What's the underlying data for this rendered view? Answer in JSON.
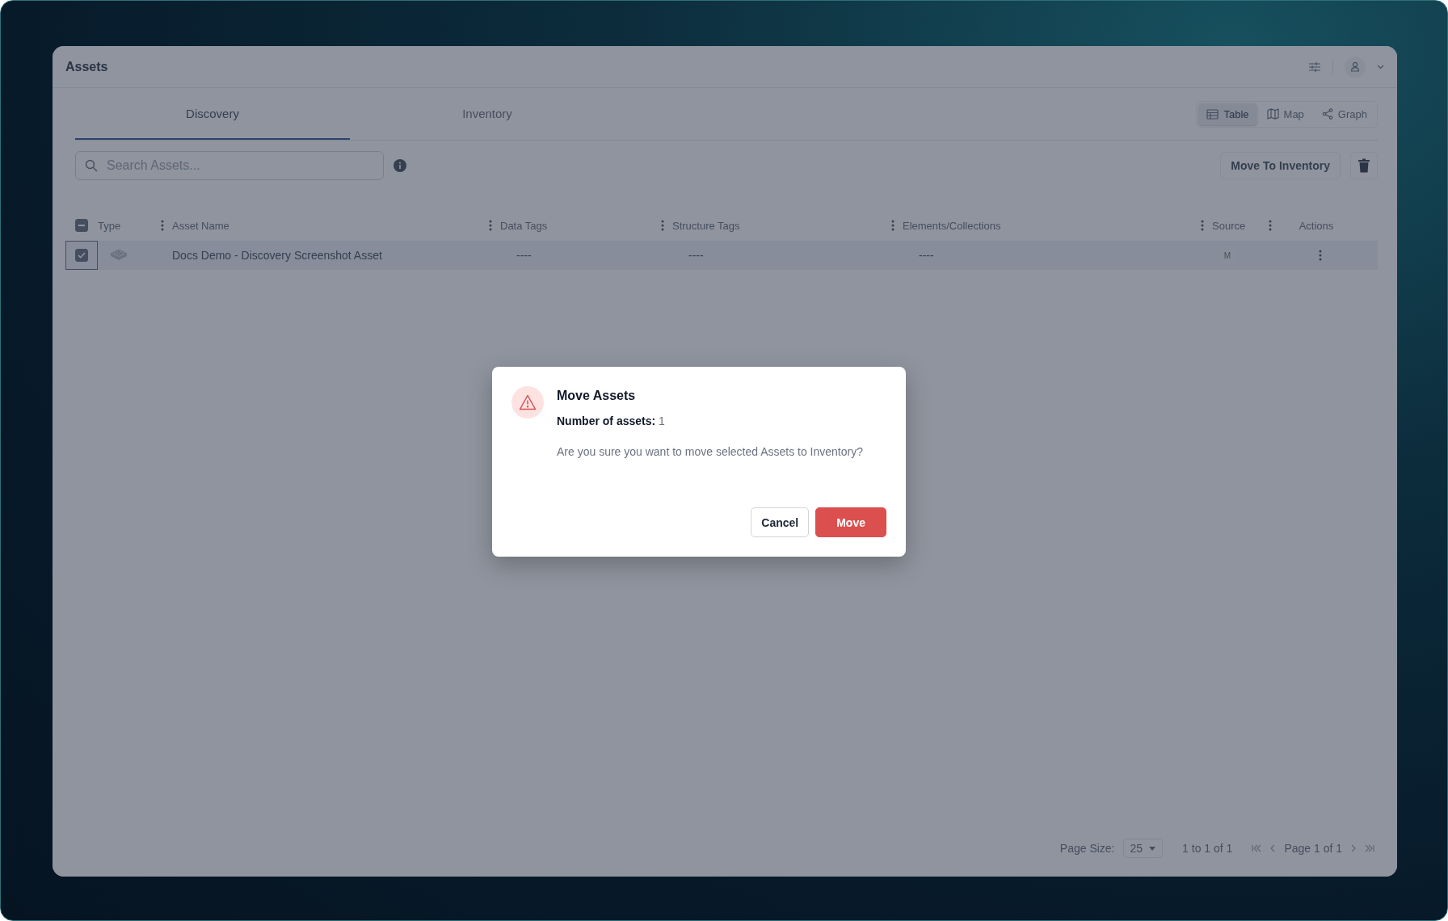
{
  "app": {
    "title": "Assets"
  },
  "tabs": [
    {
      "label": "Discovery",
      "selected": true
    },
    {
      "label": "Inventory",
      "selected": false
    }
  ],
  "views": [
    {
      "label": "Table",
      "kind": "table",
      "selected": true
    },
    {
      "label": "Map",
      "kind": "map",
      "selected": false
    },
    {
      "label": "Graph",
      "kind": "graph",
      "selected": false
    }
  ],
  "search": {
    "placeholder": "Search Assets..."
  },
  "toolbar": {
    "move_button": "Move To Inventory"
  },
  "table": {
    "select_all": {
      "indeterminate": true
    },
    "columns": [
      {
        "label": "Type",
        "menu": true
      },
      {
        "label": "Asset Name",
        "menu": true
      },
      {
        "label": "Data Tags",
        "menu": true
      },
      {
        "label": "Structure Tags",
        "menu": true
      },
      {
        "label": "Elements/Collections",
        "menu": true
      },
      {
        "label": "Source",
        "menu": true
      },
      {
        "label": "Actions",
        "menu": false
      }
    ],
    "rows": [
      {
        "checked": true,
        "asset_name": "Docs Demo - Discovery Screenshot Asset",
        "data_tags": "----",
        "structure_tags": "----",
        "elements_collections": "----",
        "source": "M"
      }
    ]
  },
  "pagination": {
    "page_size_label": "Page Size:",
    "page_size": "25",
    "range": "1 to 1 of 1",
    "page": "Page 1 of 1"
  },
  "dialog": {
    "title": "Move Assets",
    "count_label": "Number of assets:",
    "count": "1",
    "message": "Are you sure you want to move selected Assets to Inventory?",
    "buttons": [
      {
        "label": "Cancel",
        "kind": "secondary"
      },
      {
        "label": "Move",
        "kind": "danger"
      }
    ]
  }
}
